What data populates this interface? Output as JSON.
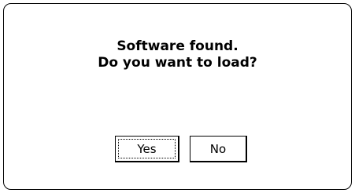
{
  "dialog": {
    "message_line1": "Software found.",
    "message_line2": "Do you want to load?",
    "buttons": {
      "yes_label": "Yes",
      "no_label": "No"
    },
    "focused_button": "yes"
  }
}
